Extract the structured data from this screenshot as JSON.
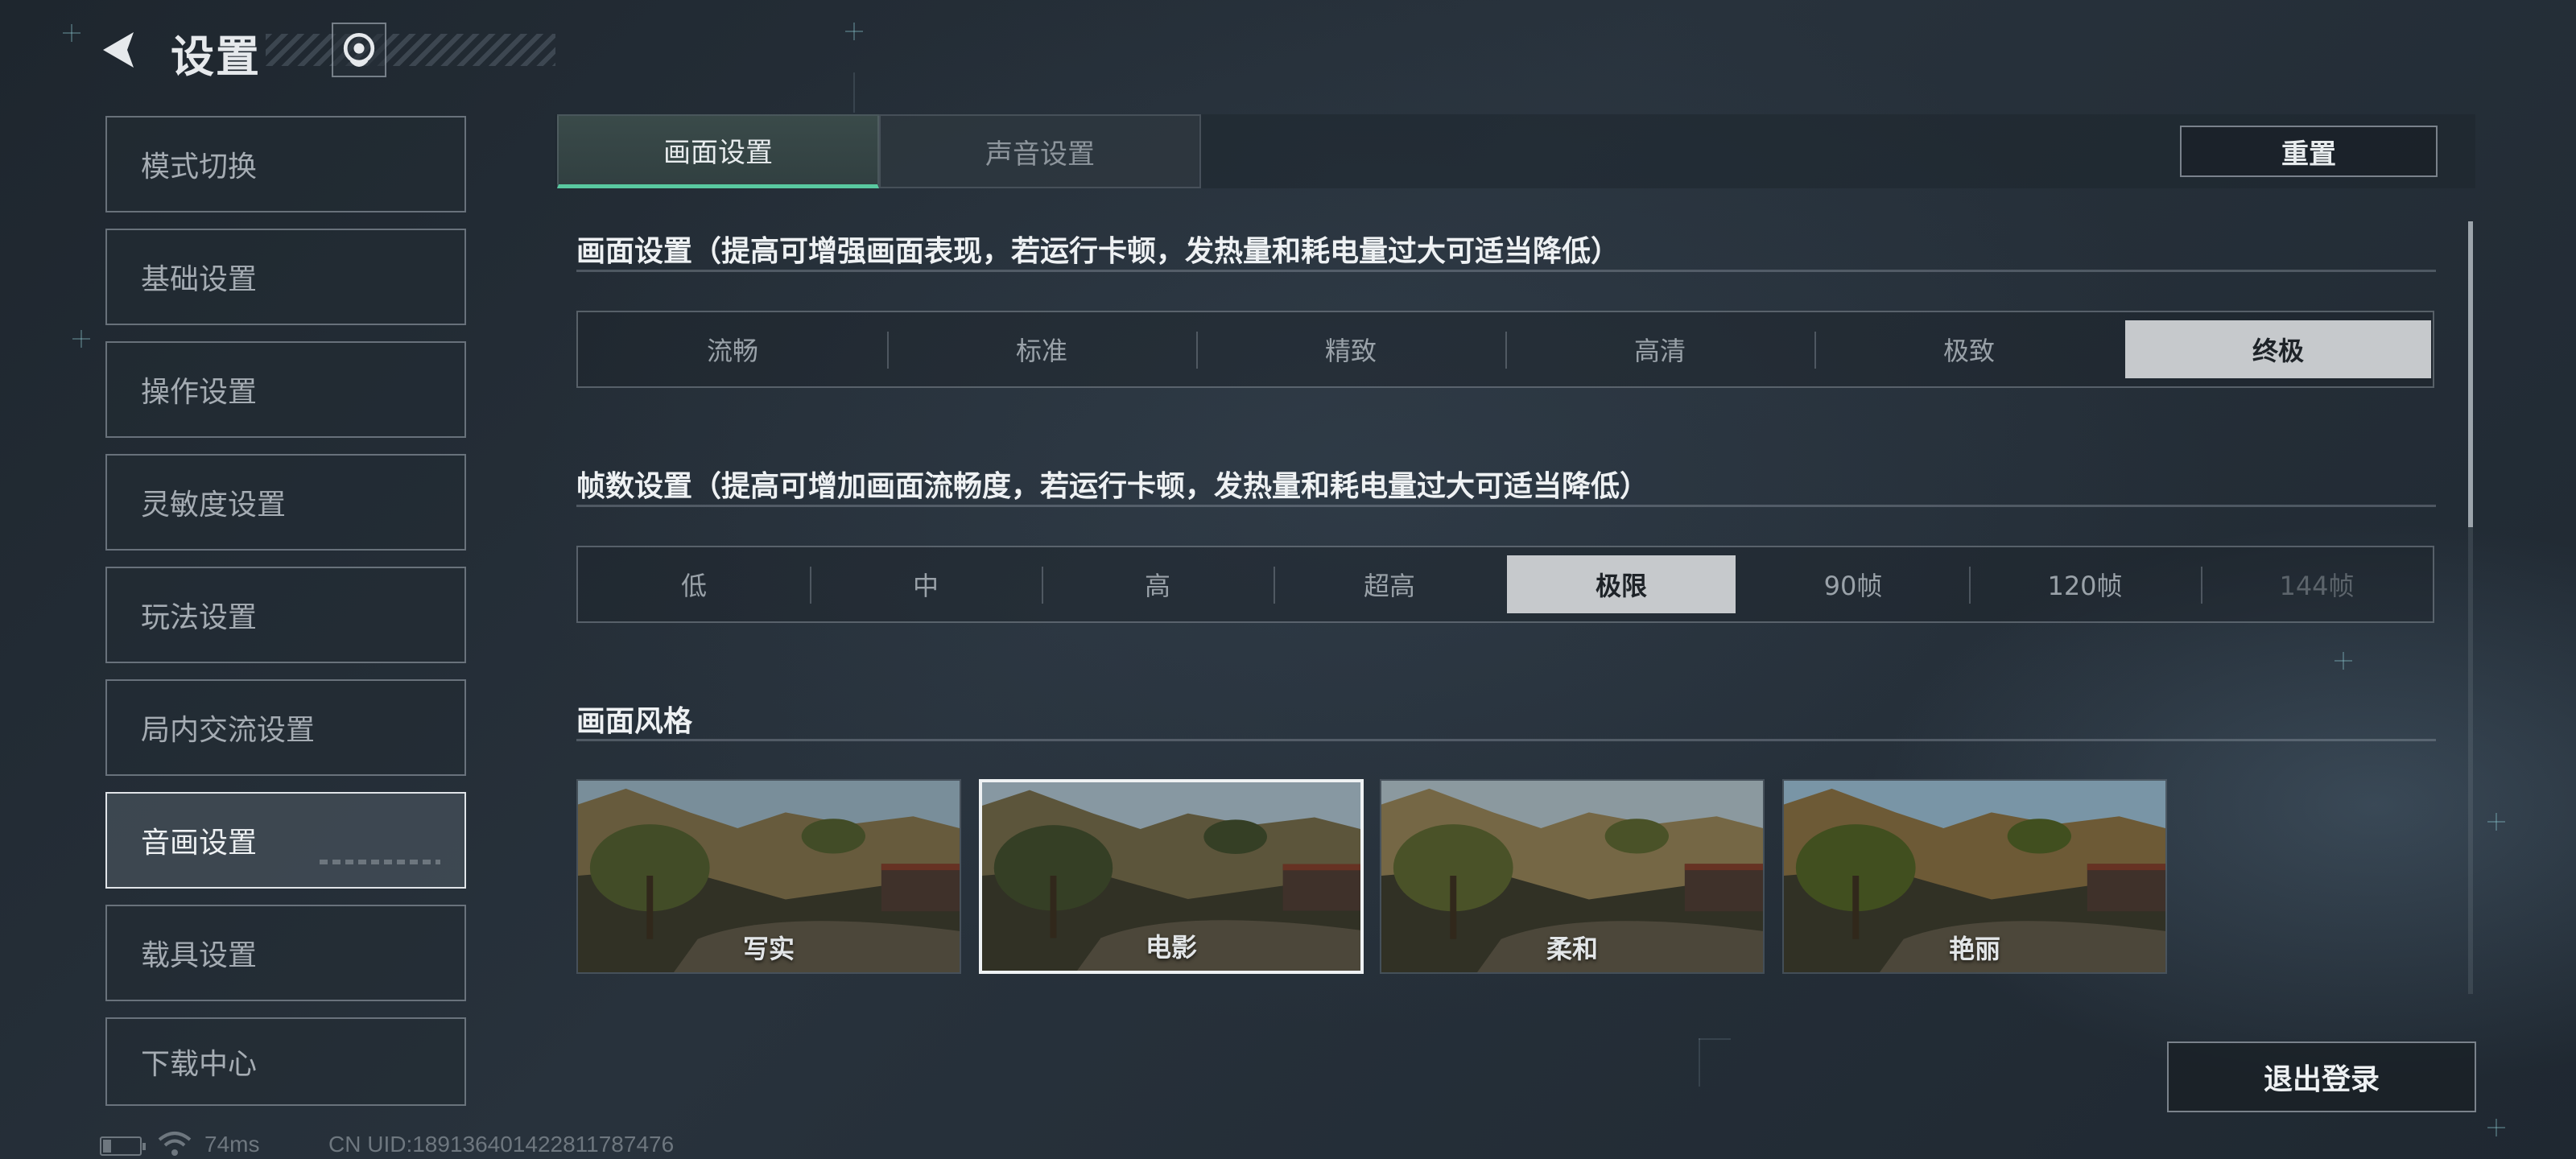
{
  "header": {
    "title": "设置",
    "back_icon": "back-arrow-icon",
    "service_icon": "customer-service-icon"
  },
  "sidebar": {
    "items": [
      {
        "label": "模式切换",
        "active": false
      },
      {
        "label": "基础设置",
        "active": false
      },
      {
        "label": "操作设置",
        "active": false
      },
      {
        "label": "灵敏度设置",
        "active": false
      },
      {
        "label": "玩法设置",
        "active": false
      },
      {
        "label": "局内交流设置",
        "active": false
      },
      {
        "label": "音画设置",
        "active": true
      },
      {
        "label": "载具设置",
        "active": false
      },
      {
        "label": "下载中心",
        "active": false
      }
    ]
  },
  "tabs": [
    {
      "label": "画面设置",
      "active": true
    },
    {
      "label": "声音设置",
      "active": false
    }
  ],
  "reset_label": "重置",
  "graphics": {
    "title": "画面设置（提高可增强画面表现，若运行卡顿，发热量和耗电量过大可适当降低）",
    "options": [
      "流畅",
      "标准",
      "精致",
      "高清",
      "极致",
      "终极"
    ],
    "selected": "终极"
  },
  "fps": {
    "title": "帧数设置（提高可增加画面流畅度，若运行卡顿，发热量和耗电量过大可适当降低）",
    "options": [
      "低",
      "中",
      "高",
      "超高",
      "极限",
      "90帧",
      "120帧",
      "144帧"
    ],
    "selected": "极限",
    "disabled": [
      "144帧"
    ]
  },
  "style": {
    "title": "画面风格",
    "options": [
      "写实",
      "电影",
      "柔和",
      "艳丽"
    ],
    "selected": "电影"
  },
  "logout_label": "退出登录",
  "status": {
    "ping": "74ms",
    "uid": "CN UID:1891364014228117874​76"
  },
  "colors": {
    "accent": "#59c9a0",
    "selected_bg": "#c6c9cc",
    "panel_bg": "#1e262e"
  }
}
